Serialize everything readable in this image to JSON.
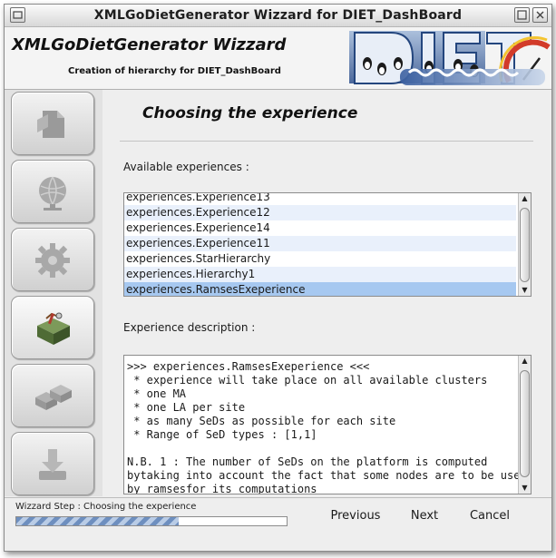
{
  "window": {
    "title": "XMLGoDietGenerator Wizzard for DIET_DashBoard"
  },
  "header": {
    "app_title": "XMLGoDietGenerator Wizzard",
    "subtitle": "Creation of hierarchy for DIET_DashBoard"
  },
  "sidebar": {
    "steps": [
      {
        "icon": "document-icon",
        "active": false
      },
      {
        "icon": "globe-network-icon",
        "active": false
      },
      {
        "icon": "gear-icon",
        "active": false
      },
      {
        "icon": "toolbox-icon",
        "active": true
      },
      {
        "icon": "blocks-icon",
        "active": false
      },
      {
        "icon": "install-download-icon",
        "active": false
      }
    ]
  },
  "main": {
    "title": "Choosing the experience",
    "available_label": "Available experiences :",
    "experiences": [
      "experiences.Experience13",
      "experiences.Experience12",
      "experiences.Experience14",
      "experiences.Experience11",
      "experiences.StarHierarchy",
      "experiences.Hierarchy1",
      "experiences.RamsesExeperience"
    ],
    "selected_index": 6,
    "description_label": "Experience description :",
    "description_lines": [
      ">>> experiences.RamsesExeperience <<<",
      " * experience will take place on all available clusters",
      " * one MA",
      " * one LA per site",
      " * as many SeDs as possible for each site",
      " * Range of SeD types : [1,1]",
      "",
      "N.B. 1 : The number of SeDs on the platform is computed",
      "bytaking into account the fact that some nodes are to be used",
      "by ramsesfor its computations"
    ]
  },
  "footer": {
    "status_label": "Wizzard Step : Choosing the experience",
    "progress": 0.6,
    "previous_label": "Previous",
    "next_label": "Next",
    "cancel_label": "Cancel"
  },
  "colors": {
    "selected_row": "#a6c8f0",
    "alt_row": "#e9f0fb",
    "progress": "#6e8fbf"
  }
}
